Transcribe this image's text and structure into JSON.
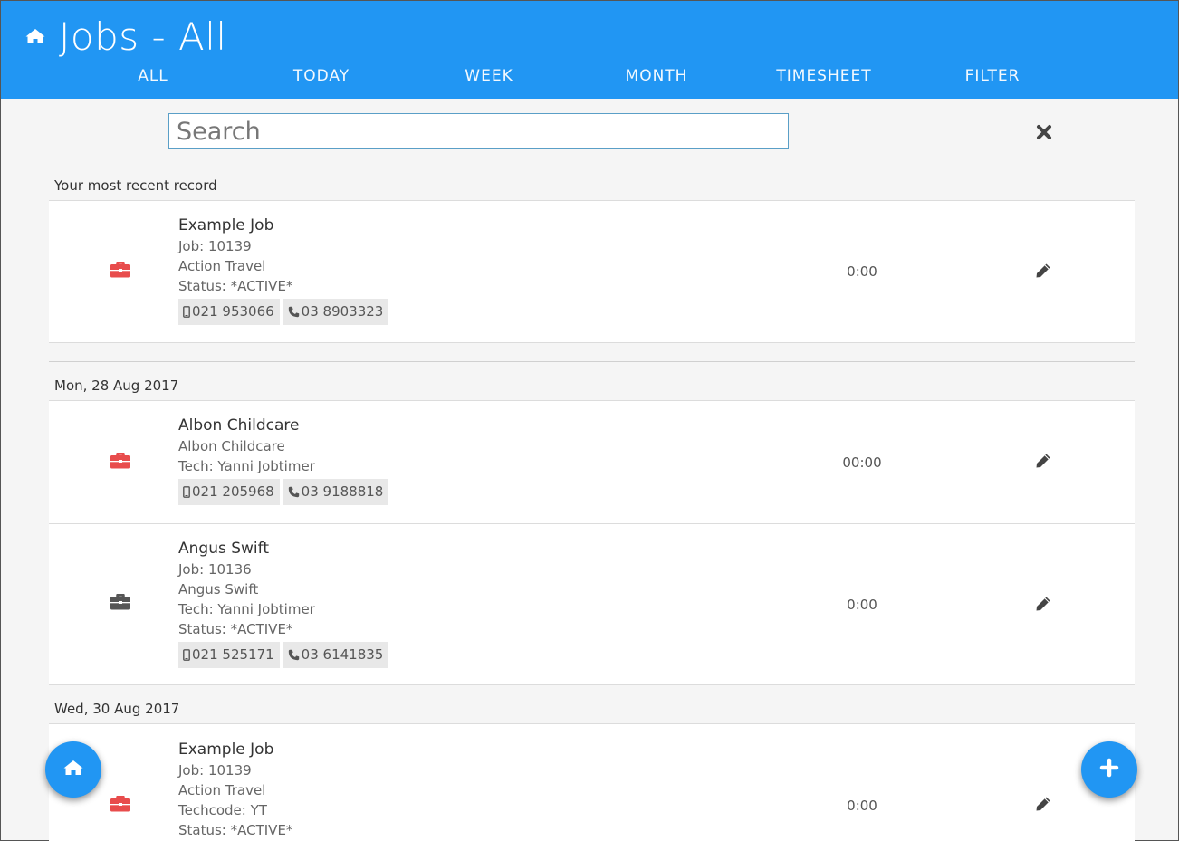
{
  "header": {
    "title": "Jobs - All",
    "home_icon": "home-icon",
    "tabs": [
      {
        "label": "ALL"
      },
      {
        "label": "TODAY"
      },
      {
        "label": "WEEK"
      },
      {
        "label": "MONTH"
      },
      {
        "label": "TIMESHEET"
      },
      {
        "label": "FILTER"
      }
    ]
  },
  "search": {
    "placeholder": "Search",
    "value": "",
    "clear_icon": "close-icon"
  },
  "colors": {
    "primary": "#2196f3",
    "job_active": "#e84c4c",
    "job_inactive": "#555555"
  },
  "recent": {
    "label": "Your most recent record",
    "rows": [
      {
        "title": "Example Job",
        "lines": [
          "Job: 10139",
          "Action Travel",
          "Status: *ACTIVE*"
        ],
        "mobile": "021 953066",
        "phone": "03 8903323",
        "duration": "0:00",
        "icon": "briefcase-icon"
      }
    ]
  },
  "groups": [
    {
      "date": "Mon, 28 Aug 2017",
      "rows": [
        {
          "title": "Albon Childcare",
          "lines": [
            "Albon Childcare",
            "Tech: Yanni Jobtimer"
          ],
          "mobile": "021 205968",
          "phone": "03 9188818",
          "duration": "00:00",
          "icon": "briefcase-icon"
        },
        {
          "title": "Angus Swift",
          "lines": [
            "Job: 10136",
            "Angus Swift",
            "Tech: Yanni Jobtimer",
            "Status: *ACTIVE*"
          ],
          "mobile": "021 525171",
          "phone": "03 6141835",
          "duration": "0:00",
          "icon": "briefcase-icon"
        }
      ]
    },
    {
      "date": "Wed, 30 Aug 2017",
      "rows": [
        {
          "title": "Example Job",
          "lines": [
            "Job: 10139",
            "Action Travel",
            "Techcode: YT",
            "Status: *ACTIVE*"
          ],
          "duration": "0:00",
          "icon": "briefcase-icon"
        }
      ]
    }
  ],
  "fabs": {
    "home_icon": "home-icon",
    "add_icon": "plus-icon"
  }
}
